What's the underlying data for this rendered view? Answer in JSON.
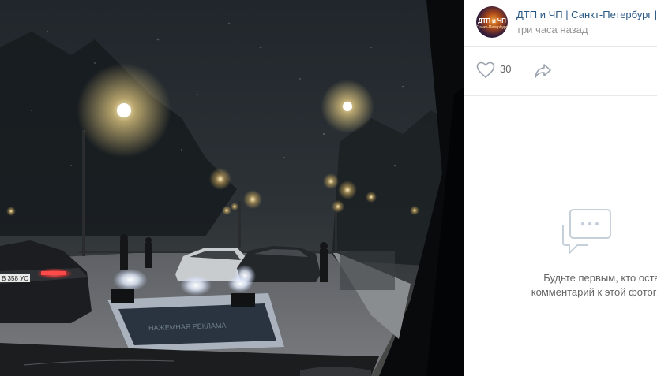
{
  "photo": {
    "description_icon": "photo",
    "plate_text": "В 358 УС",
    "sign_text": "НАЖЕМНАЯ РЕКЛАМА"
  },
  "post": {
    "author": "ДТП и ЧП | Санкт-Петербург |",
    "time": "три часа назад",
    "avatar_title": "ДТП и ЧП",
    "avatar_subtitle": "Санкт-Петербург"
  },
  "actions": {
    "likes": "30",
    "like_icon": "heart-icon",
    "share_icon": "share-arrow-icon"
  },
  "comments": {
    "empty_icon": "chat-bubble-icon",
    "empty_line1": "Будьте первым, кто оставит",
    "empty_line2": "комментарий к этой фотографии"
  },
  "colors": {
    "link": "#2a5885",
    "meta": "#939393",
    "text": "#656565",
    "divider": "#e7e8ec",
    "icon": "#aeb7c2"
  }
}
